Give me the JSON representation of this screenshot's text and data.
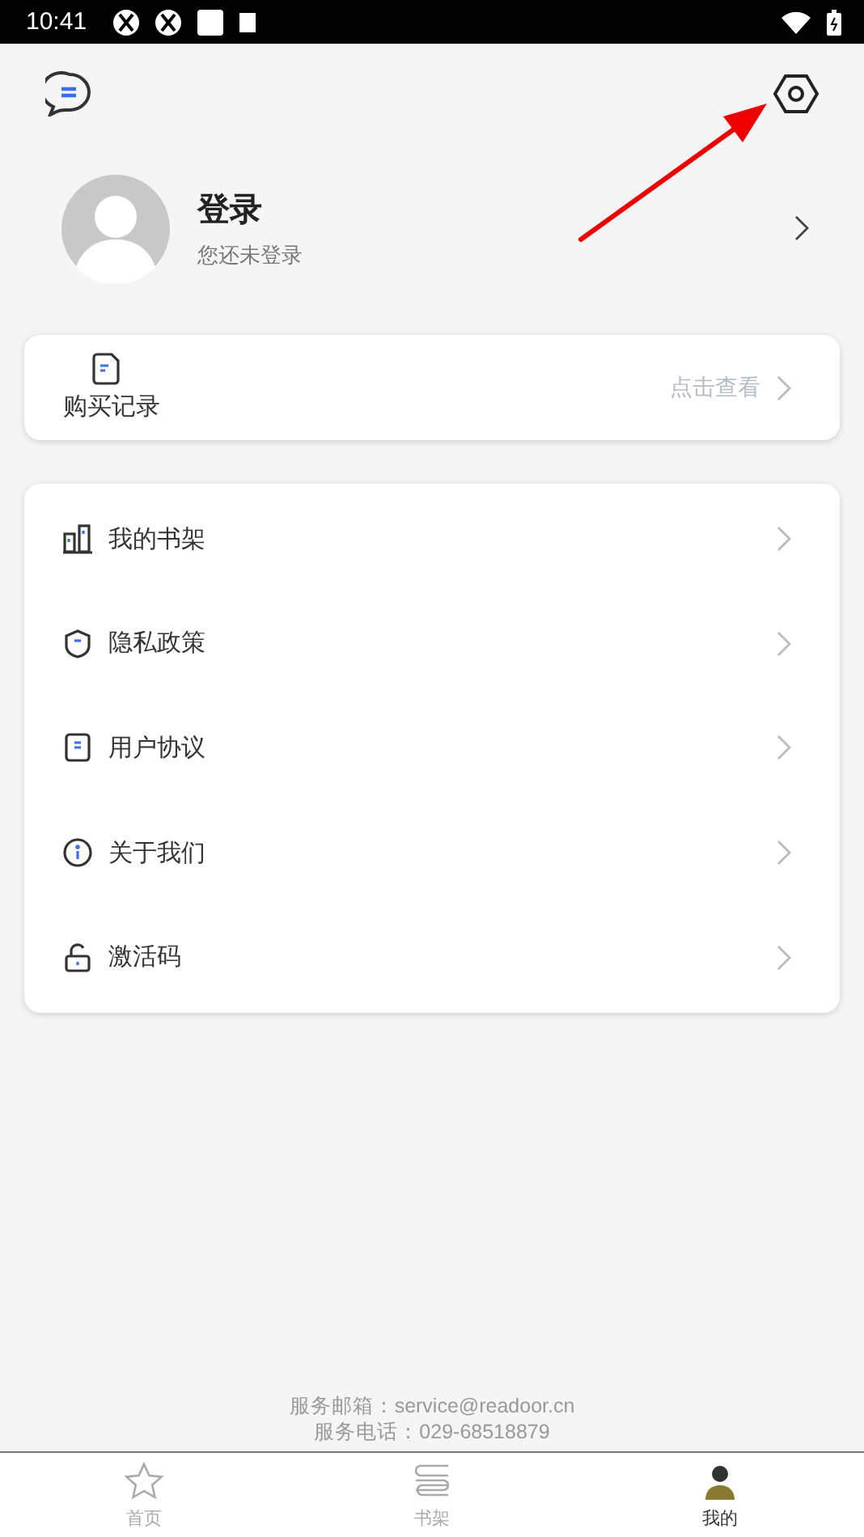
{
  "status_bar": {
    "time": "10:41"
  },
  "profile": {
    "title": "登录",
    "subtitle": "您还未登录"
  },
  "purchase_card": {
    "label": "购买记录",
    "action": "点击查看"
  },
  "menu": [
    {
      "kind": "shelf",
      "label": "我的书架"
    },
    {
      "kind": "shield",
      "label": "隐私政策"
    },
    {
      "kind": "document",
      "label": "用户协议"
    },
    {
      "kind": "info",
      "label": "关于我们"
    },
    {
      "kind": "lock",
      "label": "激活码"
    }
  ],
  "footer": [
    "服务邮箱：service@readoor.cn",
    "服务电话：029-68518879"
  ],
  "tabs": [
    {
      "kind": "star",
      "label": "首页",
      "selected": false
    },
    {
      "kind": "book",
      "label": "书架",
      "selected": false
    },
    {
      "kind": "person",
      "label": "我的",
      "selected": true
    }
  ]
}
